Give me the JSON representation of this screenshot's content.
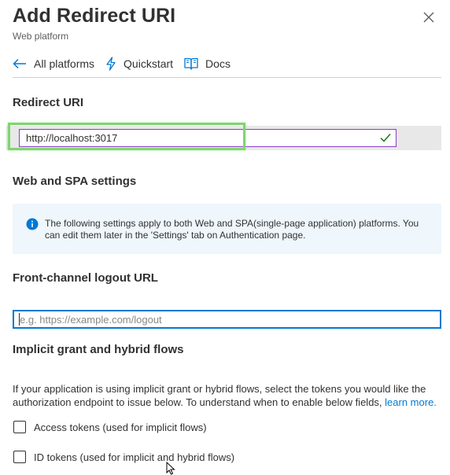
{
  "panel": {
    "title": "Add Redirect URI",
    "subtitle": "Web platform"
  },
  "toolbar": {
    "back_label": "All platforms",
    "quickstart_label": "Quickstart",
    "docs_label": "Docs"
  },
  "redirect_uri": {
    "heading": "Redirect URI",
    "value": "http://localhost:3017",
    "valid": true
  },
  "web_spa": {
    "heading": "Web and SPA settings",
    "info_text": "The following settings apply to both Web and SPA(single-page application) platforms. You can edit them later in the 'Settings' tab on Authentication page."
  },
  "logout": {
    "heading": "Front-channel logout URL",
    "value": "",
    "placeholder": "e.g. https://example.com/logout"
  },
  "implicit": {
    "heading": "Implicit grant and hybrid flows",
    "description": "If your application is using implicit grant or hybrid flows, select the tokens you would like the authorization endpoint to issue below. To understand when to enable below fields,",
    "learn_more": "learn more.",
    "options": [
      {
        "label": "Access tokens (used for implicit flows)",
        "checked": false
      },
      {
        "label": "ID tokens (used for implicit and hybrid flows)",
        "checked": false
      }
    ]
  },
  "colors": {
    "accent": "#0078d4",
    "highlight": "#7ed56f",
    "valid_check": "#107c10",
    "input_border_purple": "#8a3fc8",
    "info_bg": "#eff6fc"
  },
  "icons": {
    "close": "close-icon",
    "back": "arrow-left-icon",
    "quickstart": "lightning-icon",
    "docs": "book-icon",
    "valid": "checkmark-icon",
    "info": "info-icon",
    "pointer": "mouse-pointer-icon"
  }
}
